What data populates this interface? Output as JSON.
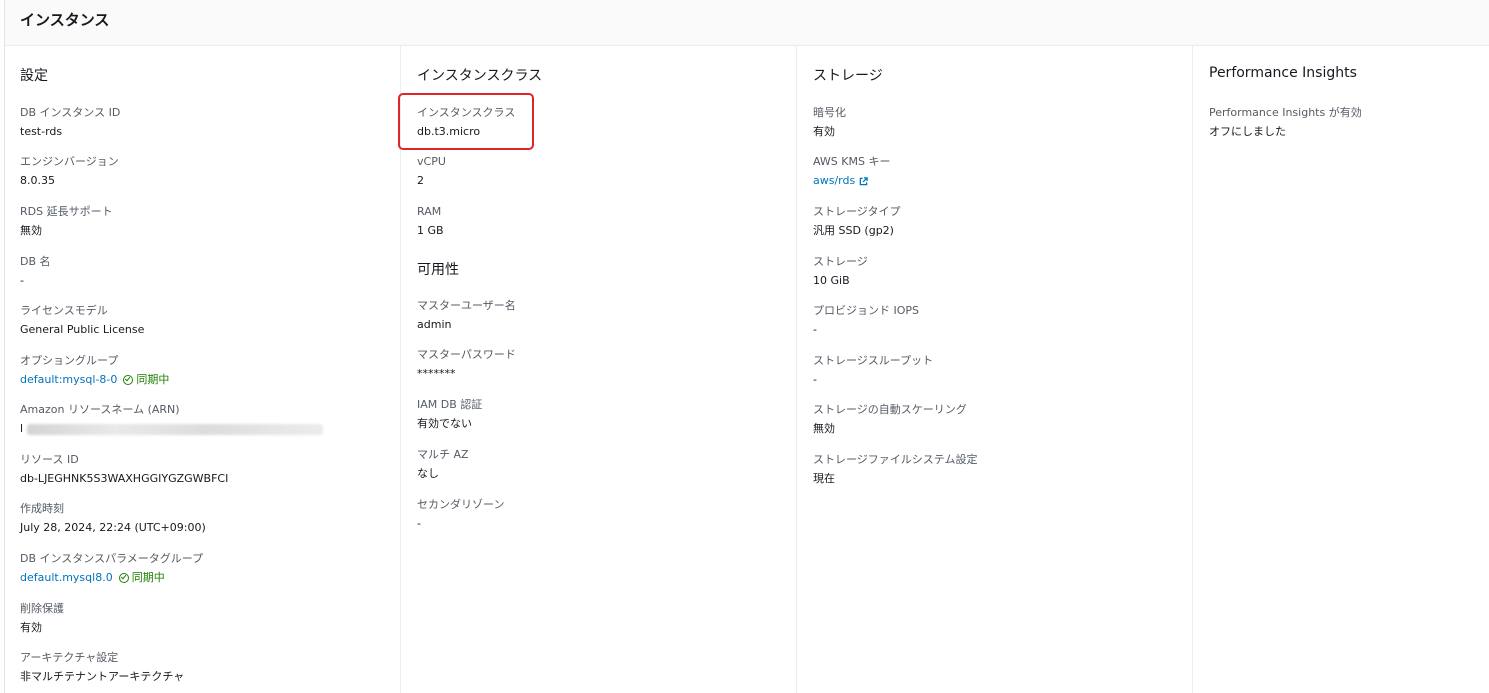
{
  "panel": {
    "title": "インスタンス"
  },
  "columns": {
    "settings": {
      "title": "設定",
      "fields": [
        {
          "label": "DB インスタンス ID",
          "value": "test-rds"
        },
        {
          "label": "エンジンバージョン",
          "value": "8.0.35"
        },
        {
          "label": "RDS 延長サポート",
          "value": "無効"
        },
        {
          "label": "DB 名",
          "value": "-"
        },
        {
          "label": "ライセンスモデル",
          "value": "General Public License"
        },
        {
          "label": "オプショングループ",
          "value": "default:mysql-8-0",
          "status": "同期中"
        },
        {
          "label": "Amazon リソースネーム (ARN)",
          "value": "l"
        },
        {
          "label": "リソース ID",
          "value": "db-LJEGHNK5S3WAXHGGIYGZGWBFCI"
        },
        {
          "label": "作成時刻",
          "value": "July 28, 2024, 22:24 (UTC+09:00)"
        },
        {
          "label": "DB インスタンスパラメータグループ",
          "value": "default.mysql8.0",
          "status": "同期中"
        },
        {
          "label": "削除保護",
          "value": "有効"
        },
        {
          "label": "アーキテクチャ設定",
          "value": "非マルチテナントアーキテクチャ"
        }
      ]
    },
    "instance_class": {
      "title": "インスタンスクラス",
      "fields": [
        {
          "label": "インスタンスクラス",
          "value": "db.t3.micro"
        },
        {
          "label": "vCPU",
          "value": "2"
        },
        {
          "label": "RAM",
          "value": "1 GB"
        }
      ],
      "availability_title": "可用性",
      "availability_fields": [
        {
          "label": "マスターユーザー名",
          "value": "admin"
        },
        {
          "label": "マスターパスワード",
          "value": "*******"
        },
        {
          "label": "IAM DB 認証",
          "value": "有効でない"
        },
        {
          "label": "マルチ AZ",
          "value": "なし"
        },
        {
          "label": "セカンダリゾーン",
          "value": "-"
        }
      ]
    },
    "storage": {
      "title": "ストレージ",
      "fields": [
        {
          "label": "暗号化",
          "value": "有効"
        },
        {
          "label": "AWS KMS キー",
          "value": "aws/rds"
        },
        {
          "label": "ストレージタイプ",
          "value": "汎用 SSD (gp2)"
        },
        {
          "label": "ストレージ",
          "value": "10 GiB"
        },
        {
          "label": "プロビジョンド IOPS",
          "value": "-"
        },
        {
          "label": "ストレージスループット",
          "value": "-"
        },
        {
          "label": "ストレージの自動スケーリング",
          "value": "無効"
        },
        {
          "label": "ストレージファイルシステム設定",
          "value": "現在"
        }
      ]
    },
    "performance": {
      "title": "Performance Insights",
      "fields": [
        {
          "label": "Performance Insights が有効",
          "value": "オフにしました"
        }
      ]
    }
  },
  "colors": {
    "link": "#0073bb",
    "status_ok": "#1d8102",
    "highlight": "#e0252a"
  }
}
